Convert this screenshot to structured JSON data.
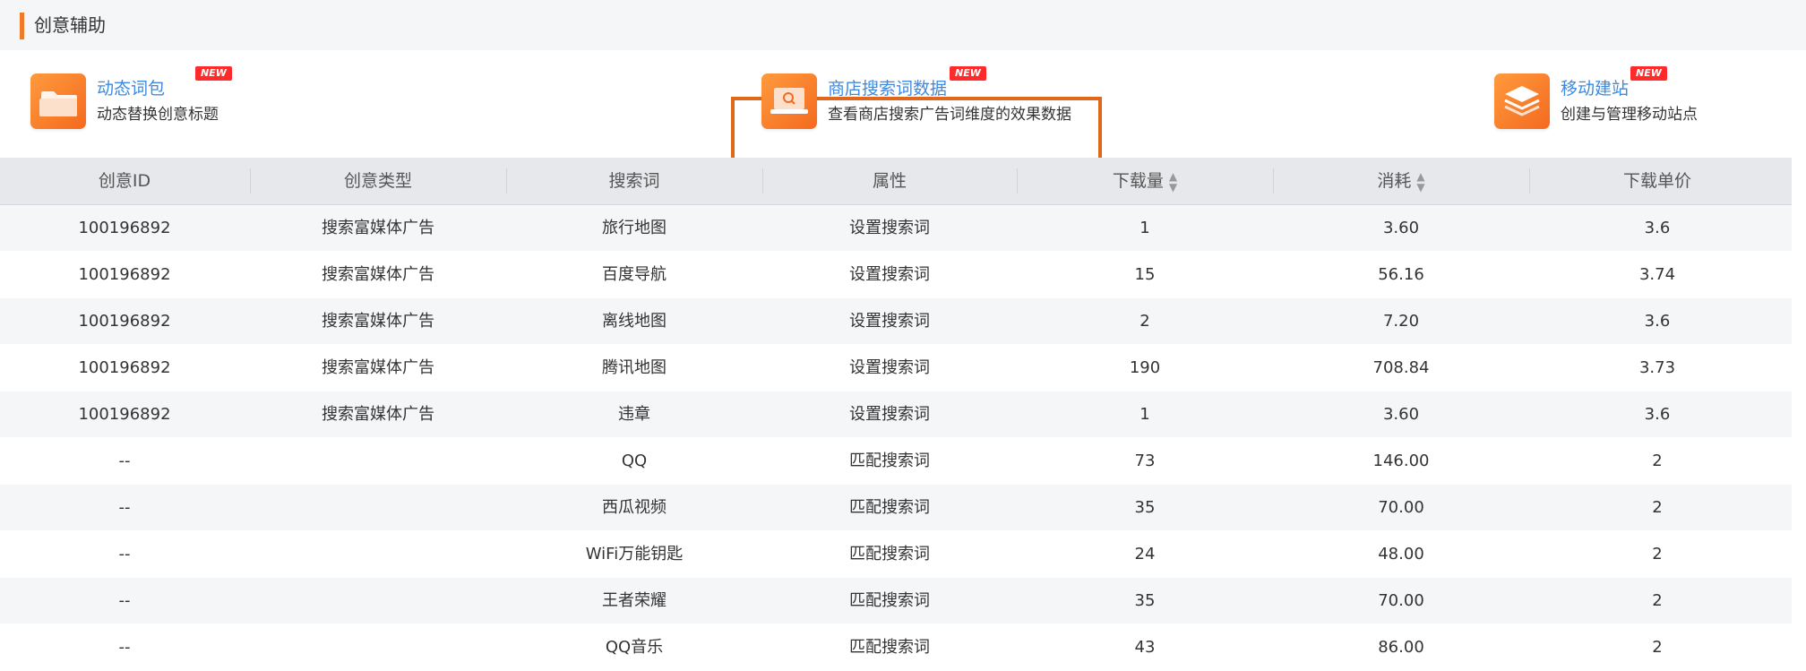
{
  "header": {
    "title": "创意辅助"
  },
  "tools": [
    {
      "name": "动态词包",
      "desc": "动态替换创意标题",
      "badge": "NEW",
      "icon": "folder-icon"
    },
    {
      "name": "商店搜索词数据",
      "desc": "查看商店搜索广告词维度的效果数据",
      "badge": "NEW",
      "icon": "laptop-search-icon"
    },
    {
      "name": "移动建站",
      "desc": "创建与管理移动站点",
      "badge": "NEW",
      "icon": "layers-icon"
    }
  ],
  "table": {
    "columns": [
      "创意ID",
      "创意类型",
      "搜索词",
      "属性",
      "下载量",
      "消耗",
      "下载单价"
    ],
    "sortable_columns": [
      "下载量",
      "消耗"
    ],
    "rows": [
      [
        "100196892",
        "搜索富媒体广告",
        "旅行地图",
        "设置搜索词",
        "1",
        "3.60",
        "3.6"
      ],
      [
        "100196892",
        "搜索富媒体广告",
        "百度导航",
        "设置搜索词",
        "15",
        "56.16",
        "3.74"
      ],
      [
        "100196892",
        "搜索富媒体广告",
        "离线地图",
        "设置搜索词",
        "2",
        "7.20",
        "3.6"
      ],
      [
        "100196892",
        "搜索富媒体广告",
        "腾讯地图",
        "设置搜索词",
        "190",
        "708.84",
        "3.73"
      ],
      [
        "100196892",
        "搜索富媒体广告",
        "违章",
        "设置搜索词",
        "1",
        "3.60",
        "3.6"
      ],
      [
        "--",
        "",
        "QQ",
        "匹配搜索词",
        "73",
        "146.00",
        "2"
      ],
      [
        "--",
        "",
        "西瓜视频",
        "匹配搜索词",
        "35",
        "70.00",
        "2"
      ],
      [
        "--",
        "",
        "WiFi万能钥匙",
        "匹配搜索词",
        "24",
        "48.00",
        "2"
      ],
      [
        "--",
        "",
        "王者荣耀",
        "匹配搜索词",
        "35",
        "70.00",
        "2"
      ],
      [
        "--",
        "",
        "QQ音乐",
        "匹配搜索词",
        "43",
        "86.00",
        "2"
      ]
    ]
  },
  "colors": {
    "accent": "#f07a28",
    "link": "#3d8ae0",
    "badge": "#ff2b2b",
    "highlight_border": "#e0671c"
  }
}
